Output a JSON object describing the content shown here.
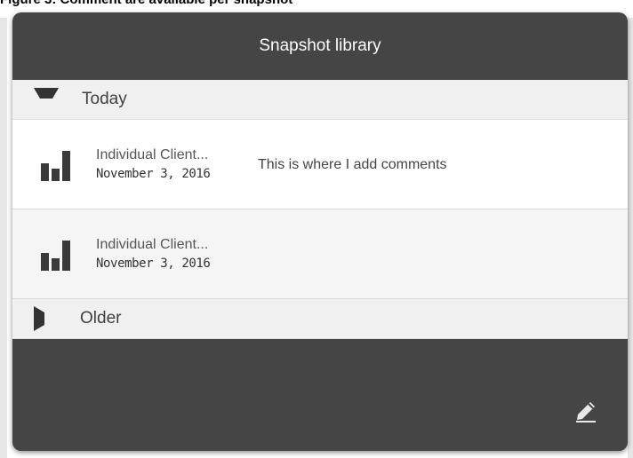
{
  "caption": "Figure 3: Comment are available per snapshot",
  "dialog": {
    "title": "Snapshot library",
    "groups": [
      {
        "label": "Today",
        "expanded": true,
        "items": [
          {
            "name": "Individual Client...",
            "date": "November 3, 2016",
            "comment": "This is where I add comments"
          },
          {
            "name": "Individual Client...",
            "date": "November 3, 2016",
            "comment": ""
          }
        ]
      },
      {
        "label": "Older",
        "expanded": false
      }
    ],
    "icons": {
      "expand": "triangle-down-icon",
      "collapse": "triangle-right-icon",
      "snapshot": "bar-chart-icon",
      "edit": "pencil-icon"
    }
  },
  "colors": {
    "dialog_bg": "#454545",
    "group_bg": "#f0f0f0",
    "item_bg": "#ffffff"
  }
}
